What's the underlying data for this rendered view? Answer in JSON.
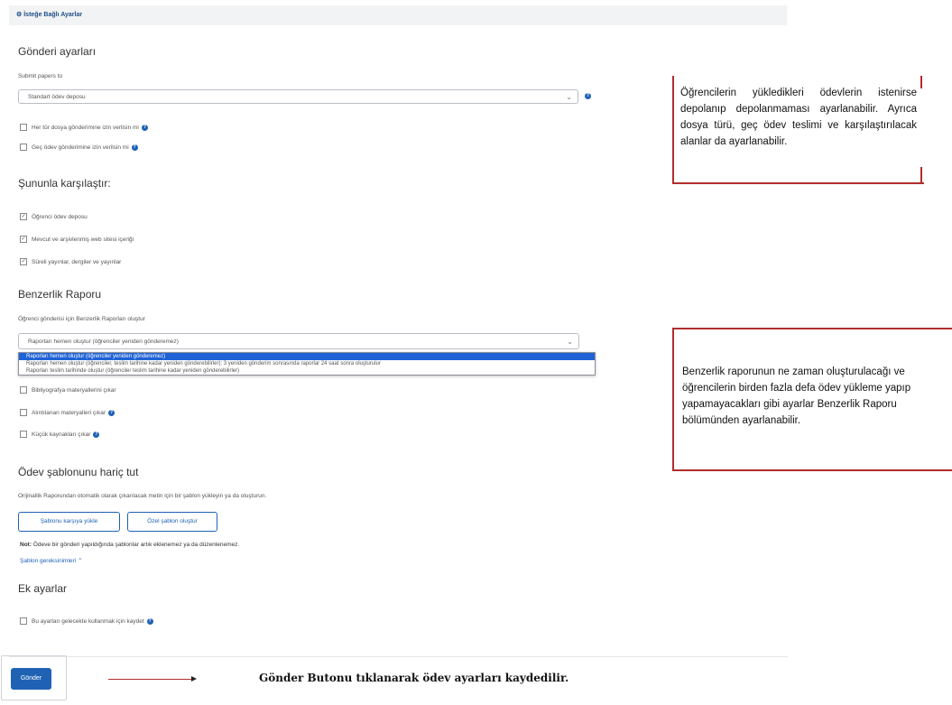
{
  "panel": {
    "title": "İsteğe Bağlı Ayarlar"
  },
  "submission": {
    "heading": "Gönderi ayarları",
    "submit_label": "Submit papers to",
    "submit_value": "Standart ödev deposu",
    "allow_any_file": "Her tür dosya gönderimine izin verilsin mi",
    "allow_late": "Geç ödev gönderimine izin verilsin mi"
  },
  "compare": {
    "heading": "Şununla karşılaştır:",
    "items": [
      {
        "label": "Öğrenci ödev deposu",
        "checked": true
      },
      {
        "label": "Mevcut ve arşivlenmiş web sitesi içeriği",
        "checked": true
      },
      {
        "label": "Süreli yayınlar, dergiler ve yayınlar",
        "checked": true
      }
    ]
  },
  "similarity": {
    "heading": "Benzerlik Raporu",
    "generate_label": "Öğrenci gönderisi için Benzerlik Raporları oluştur",
    "selected": "Raporları hemen oluştur (öğrenciler yeniden gönderemez)",
    "options": [
      "Raporları hemen oluştur (öğrenciler yeniden gönderemez)",
      "Raporları hemen oluştur (öğrenciler, teslim tarihine kadar yeniden gönderebilirler): 3 yeniden gönderim sonrasında raporlar 24 saat sonra oluşturulur",
      "Raporları teslim tarihinde oluştur (öğrenciler teslim tarihine kadar yeniden gönderebilirler)"
    ],
    "exclude_bib": "Bibliyografya materyallerini çıkar",
    "exclude_quotes": "Alıntılanan materyalleri çıkar",
    "exclude_small": "Küçük kaynakları çıkar"
  },
  "template": {
    "heading": "Ödev şablonunu hariç tut",
    "desc": "Orijinallik Raporundan otomatik olarak çıkarılacak metin için bir şablon yükleyin ya da oluşturun.",
    "upload_button": "Şablonu karşıya yükle",
    "create_button": "Özel şablon oluştur",
    "note_bold": "Not:",
    "note_text": " Ödeve bir gönderi yapıldığında şablonlar artık eklenemez ya da düzenlenemez.",
    "requirements_link": "Şablon gereksinimleri"
  },
  "extra": {
    "heading": "Ek ayarlar",
    "save_future": "Bu ayarları gelecekte kullanmak için kaydet"
  },
  "submit_button": "Gönder",
  "annotations": {
    "note1": "Öğrencilerin yükledikleri ödevlerin istenirse depolanıp depolanmaması ayarlanabilir. Ayrıca dosya türü, geç ödev teslimi ve karşılaştırılacak alanlar da ayarlanabilir.",
    "note2": "Benzerlik raporunun ne zaman oluşturulacağı ve öğrencilerin birden fazla defa ödev yükleme yapıp yapamayacakları gibi ayarlar Benzerlik Raporu bölümünden ayarlanabilir.",
    "caption": "Gönder Butonu tıklanarak ödev ayarları kaydedilir."
  },
  "colors": {
    "accent": "#1f62b4",
    "annotation_red": "#b22d2d"
  }
}
